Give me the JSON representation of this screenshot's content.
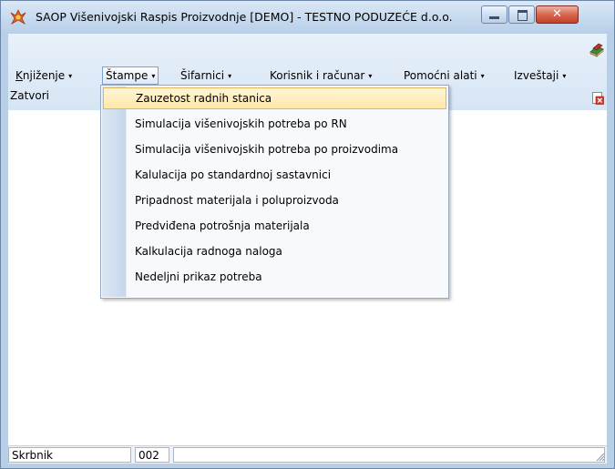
{
  "window": {
    "title": "SAOP  Višenivojski Raspis Proizvodnje [DEMO] - TESTNO PODUZEĆE d.o.o.",
    "min_glyph": "",
    "max_glyph": "",
    "close_glyph": "✕"
  },
  "menubar": {
    "items": [
      {
        "label": "Knjiženje",
        "arrow": "▾"
      },
      {
        "label": "Štampe",
        "arrow": "▾"
      },
      {
        "label": "Šifarnici",
        "arrow": "▾"
      },
      {
        "label": "Korisnik i računar",
        "arrow": "▾"
      },
      {
        "label": "Pomoćni alati",
        "arrow": "▾"
      },
      {
        "label": "Izveštaji",
        "arrow": "▾"
      }
    ],
    "close_label": "Zatvori"
  },
  "dropdown": {
    "items": [
      {
        "label": "Zauzetost radnih stanica"
      },
      {
        "label": "Simulacija višenivojskih potreba po RN"
      },
      {
        "label": "Simulacija višenivojskih potreba po proizvodima"
      },
      {
        "label": "Kalulacija po standardnoj sastavnici"
      },
      {
        "label": "Pripadnost materijala i poluproizvoda"
      },
      {
        "label": "Predviđena potrošnja materijala"
      },
      {
        "label": "Kalkulacija radnoga naloga"
      },
      {
        "label": "Nedeljni prikaz potreba"
      }
    ]
  },
  "statusbar": {
    "user": "Skrbnik",
    "code": "002",
    "info": ""
  },
  "colors": {
    "titlebar": "#c4d8ee",
    "menubar": "#dce8f6",
    "highlight": "#ffe7a6",
    "close_button": "#c2412a"
  },
  "icons": {
    "app": "app-logo-icon",
    "books": "books-icon",
    "close_doc": "close-document-icon"
  }
}
